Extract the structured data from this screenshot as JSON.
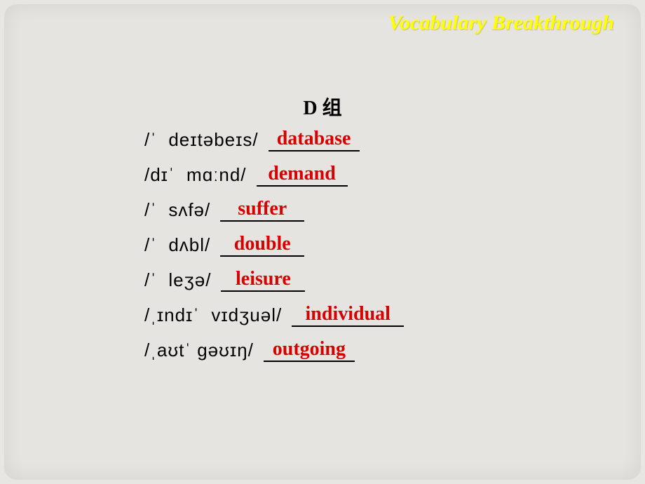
{
  "header": {
    "title": "Vocabulary Breakthrough"
  },
  "group": {
    "label": "D 组"
  },
  "items": [
    {
      "ipa": "/ˈ  deɪtəbeɪs/",
      "answer": "database",
      "blank_width": 130
    },
    {
      "ipa": "/dɪˈ  mɑːnd/",
      "answer": "demand",
      "blank_width": 130
    },
    {
      "ipa": "/ˈ  sʌfə/",
      "answer": "suffer",
      "blank_width": 120
    },
    {
      "ipa": "/ˈ  dʌbl/",
      "answer": "double",
      "blank_width": 120
    },
    {
      "ipa": "/ˈ  leʒə/",
      "answer": "leisure",
      "blank_width": 120
    },
    {
      "ipa": "/ˌɪndɪˈ  vɪdʒuəl/",
      "answer": "individual",
      "blank_width": 160
    },
    {
      "ipa": "/ˌaʊtˈ gəʊɪŋ/",
      "answer": "outgoing",
      "blank_width": 130
    }
  ]
}
